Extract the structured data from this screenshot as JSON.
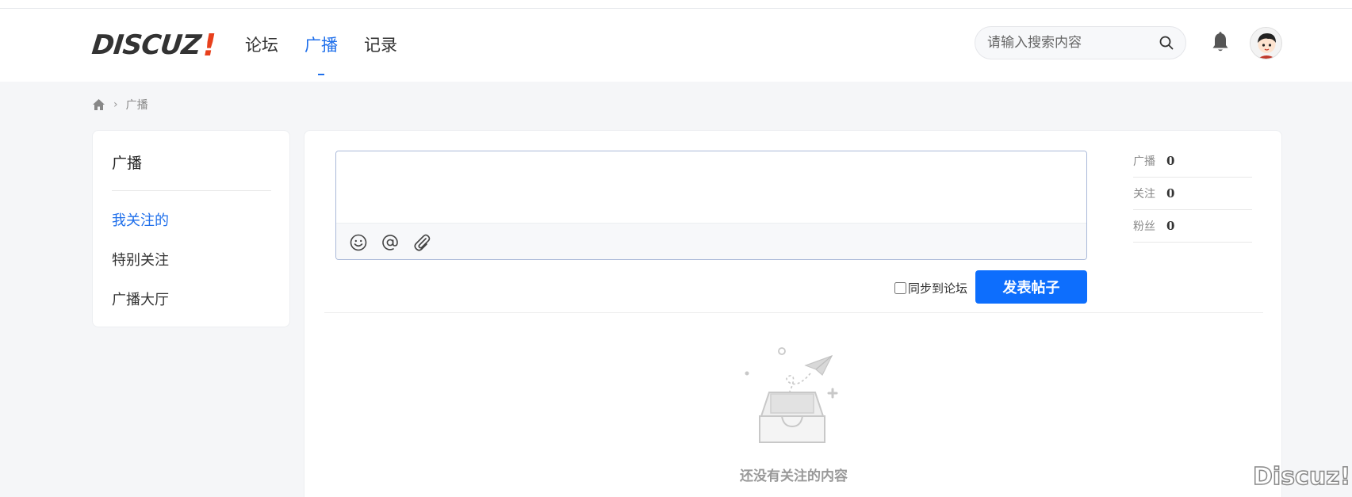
{
  "header": {
    "logo_text": "DISCUZ",
    "logo_mark": "!",
    "nav": [
      {
        "label": "论坛",
        "active": false
      },
      {
        "label": "广播",
        "active": true
      },
      {
        "label": "记录",
        "active": false
      }
    ],
    "search_placeholder": "请输入搜索内容",
    "icons": {
      "search": "search-icon",
      "bell": "bell-icon",
      "avatar": "user-avatar"
    }
  },
  "breadcrumb": {
    "home_icon": "home-icon",
    "separator": "›",
    "current": "广播"
  },
  "sidebar": {
    "title": "广播",
    "items": [
      {
        "label": "我关注的",
        "active": true
      },
      {
        "label": "特别关注",
        "active": false
      },
      {
        "label": "广播大厅",
        "active": false
      }
    ]
  },
  "composer": {
    "tools": [
      "smile-icon",
      "at-icon",
      "attachment-icon"
    ],
    "sync_label": "同步到论坛",
    "post_button": "发表帖子"
  },
  "stats": [
    {
      "label": "广播",
      "value": "0"
    },
    {
      "label": "关注",
      "value": "0"
    },
    {
      "label": "粉丝",
      "value": "0"
    }
  ],
  "empty_state": {
    "text": "还没有关注的内容",
    "icon": "empty-inbox-icon"
  },
  "watermark": "Discuz!",
  "colors": {
    "accent": "#0d6efd",
    "logo_mark": "#e8401c"
  }
}
